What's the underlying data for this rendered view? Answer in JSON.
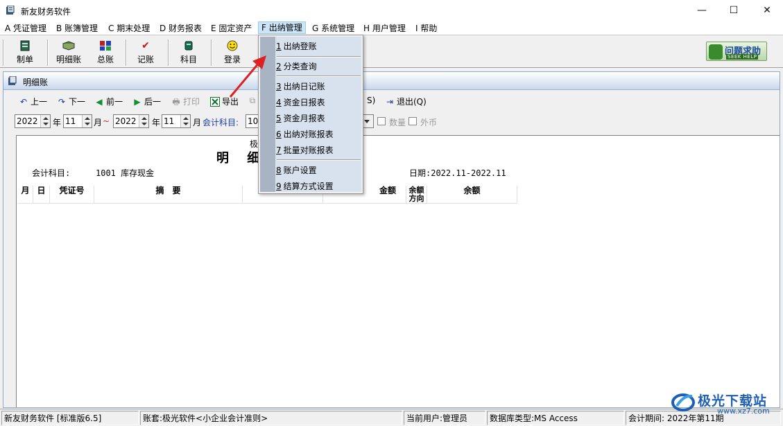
{
  "window": {
    "title": "新友财务软件",
    "minimize_glyph": "—",
    "maximize_glyph": "☐",
    "close_glyph": "✕"
  },
  "menubar": {
    "items": [
      {
        "label": "A 凭证管理"
      },
      {
        "label": "B 账簿管理"
      },
      {
        "label": "C 期末处理"
      },
      {
        "label": "D 财务报表"
      },
      {
        "label": "E 固定资产"
      },
      {
        "label": "F 出纳管理",
        "active": true
      },
      {
        "label": "G 系统管理"
      },
      {
        "label": "H 用户管理"
      },
      {
        "label": "I 帮助"
      }
    ]
  },
  "toolbar": {
    "buttons": [
      {
        "label": "制单",
        "icon": "document-icon"
      },
      {
        "label": "明细账",
        "icon": "book-icon"
      },
      {
        "label": "总账",
        "icon": "ledger-icon"
      },
      {
        "label": "记账",
        "icon": "checkmark-icon"
      },
      {
        "label": "科目",
        "icon": "books-icon"
      },
      {
        "label": "登录",
        "icon": "smiley-icon"
      }
    ],
    "help_button": {
      "label": "问题求助",
      "sublabel": "SEEK HELP"
    }
  },
  "child_window": {
    "title": "明细账",
    "nav": {
      "prev_label": "上一",
      "next_label": "下一",
      "front_label": "前一",
      "back_label": "后一",
      "print_label": "打印",
      "export_label": "导出",
      "partial_label": "S)",
      "exit_label": "退出(Q)"
    },
    "filters": {
      "start_year": "2022",
      "year_label_1": "年",
      "start_month": "11",
      "month_label_1": "月",
      "tilde": "~",
      "end_year": "2022",
      "year_label_2": "年",
      "end_month": "11",
      "month_label_2": "月",
      "account_label": "会计科目:",
      "account_value": "10",
      "quantity_label": "数量",
      "foreign_label": "外币"
    },
    "report": {
      "company_partial": "极",
      "title_partial": "明 细",
      "account_label": "会计科目:",
      "account_value": "1001 库存现金",
      "date_label": "日期:2022.11-2022.11",
      "columns": [
        "月",
        "日",
        "凭证号",
        "摘　要",
        "",
        "金额",
        "余额方向",
        "余额"
      ]
    }
  },
  "dropdown": {
    "items": [
      {
        "key": "1",
        "label": "出纳登账"
      },
      {
        "key": "2",
        "label": "分类查询"
      },
      {
        "key": "3",
        "label": "出纳日记账"
      },
      {
        "key": "4",
        "label": "资金日报表"
      },
      {
        "key": "5",
        "label": "资金月报表"
      },
      {
        "key": "6",
        "label": "出纳对账报表"
      },
      {
        "key": "7",
        "label": "批量对账报表"
      },
      {
        "key": "8",
        "label": "账户设置"
      },
      {
        "key": "9",
        "label": "结算方式设置"
      }
    ]
  },
  "statusbar": {
    "app": "新友财务软件 [标准版6.5]",
    "book": "账套:极光软件<小企业会计准则>",
    "user": "当前用户:管理员",
    "db": "数据库类型:MS Access",
    "period": "会计期间: 2022年第11期"
  },
  "watermark": {
    "brand": "极光下载站",
    "url": "www.xz7.com"
  },
  "colors": {
    "accent_blue": "#1e5fb4",
    "arrow_red": "#e02020",
    "menu_highlight": "#cce4f7"
  }
}
